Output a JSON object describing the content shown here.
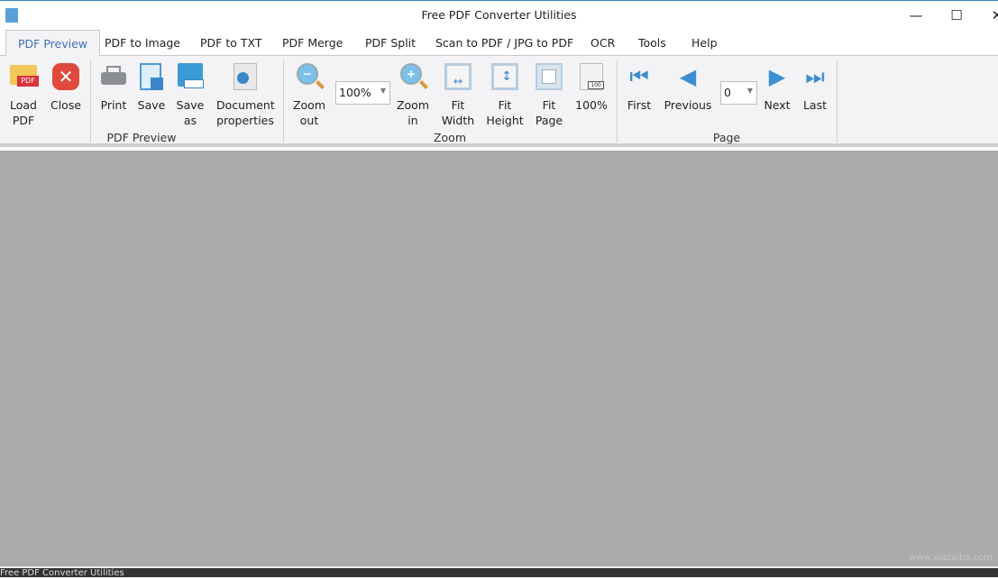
{
  "window": {
    "title": "Free PDF Converter Utilities",
    "minimize": "—",
    "maximize": "☐",
    "close": "✕"
  },
  "tabs": [
    {
      "label": "PDF Preview",
      "active": true
    },
    {
      "label": "PDF to Image"
    },
    {
      "label": "PDF to TXT"
    },
    {
      "label": "PDF Merge"
    },
    {
      "label": "PDF Split"
    },
    {
      "label": "Scan to PDF / JPG to PDF"
    },
    {
      "label": "OCR"
    },
    {
      "label": "Tools"
    },
    {
      "label": "Help"
    }
  ],
  "ribbon": {
    "preview": {
      "label": "PDF Preview",
      "load": [
        "Load",
        "PDF"
      ],
      "close": "Close",
      "print": "Print",
      "save": "Save",
      "save_as": [
        "Save",
        "as"
      ],
      "doc_props": [
        "Document",
        "properties"
      ],
      "pdf_badge": "PDF"
    },
    "zoom": {
      "label": "Zoom",
      "zoom_out": [
        "Zoom",
        "out"
      ],
      "zoom_value": "100%",
      "zoom_in": [
        "Zoom",
        "in"
      ],
      "fit_width": [
        "Fit",
        "Width"
      ],
      "fit_height": [
        "Fit",
        "Height"
      ],
      "fit_page": [
        "Fit",
        "Page"
      ],
      "actual": "100%",
      "actual_badge": "100"
    },
    "page": {
      "label": "Page",
      "first": "First",
      "previous": "Previous",
      "page_value": "0",
      "next": "Next",
      "last": "Last"
    }
  },
  "statusbar": {
    "text": "Free PDF Converter Utilities"
  },
  "watermark": "www.xiazaiba.com"
}
